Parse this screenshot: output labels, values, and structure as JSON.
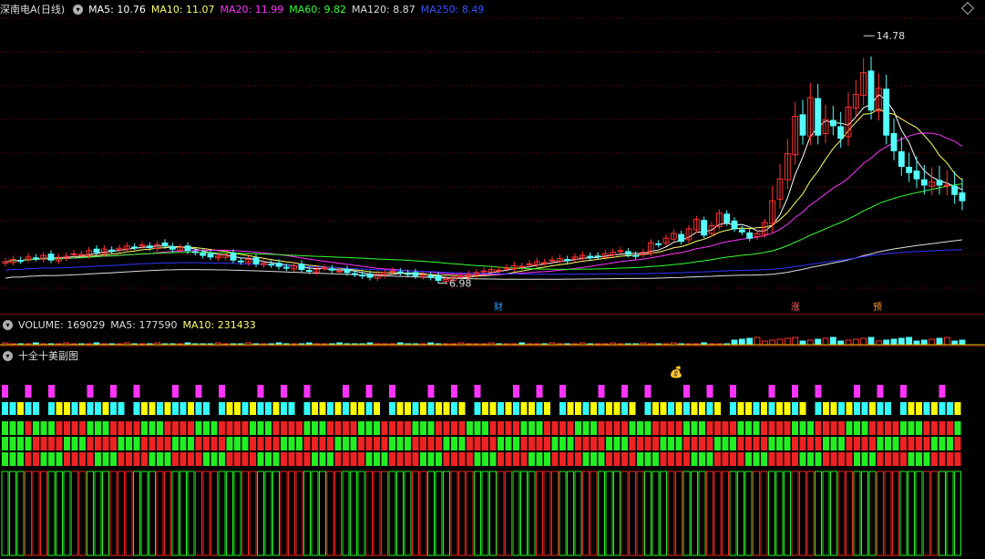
{
  "colors": {
    "up": "#ff3232",
    "down": "#54ffff",
    "grid": "#8b0000",
    "ma5": "#ffffff",
    "ma10": "#ffff66",
    "ma20": "#ff33ff",
    "ma60": "#33ff33",
    "ma120": "#dddddd",
    "ma250": "#3333ff"
  },
  "legend": {
    "stock": "深南电A(日线)",
    "ma5": "MA5: 10.76",
    "ma10": "MA10: 11.07",
    "ma20": "MA20: 11.99",
    "ma60": "MA60: 9.82",
    "ma120": "MA120: 8.87",
    "ma250": "MA250: 8.49"
  },
  "volume_legend": {
    "volume": "VOLUME: 169029",
    "ma5": "MA5: 177590",
    "ma10": "MA10: 231433"
  },
  "sub_legend": {
    "title": "十全十美副图"
  },
  "tags": {
    "cai": "财",
    "zhang": "涨",
    "yu": "预",
    "moneybag": "💰"
  },
  "chart_data": {
    "type": "candlestick",
    "price_range": [
      6.0,
      15.4
    ],
    "high_label": "14.78",
    "low_label": "6.98",
    "closes": [
      7.55,
      7.62,
      7.58,
      7.7,
      7.66,
      7.74,
      7.6,
      7.69,
      7.72,
      7.8,
      7.78,
      7.9,
      7.85,
      7.95,
      7.88,
      7.98,
      8.05,
      8.02,
      8.08,
      8.0,
      8.1,
      8.06,
      7.95,
      8.0,
      7.9,
      7.85,
      7.75,
      7.7,
      7.72,
      7.78,
      7.6,
      7.55,
      7.62,
      7.48,
      7.5,
      7.45,
      7.4,
      7.35,
      7.42,
      7.3,
      7.25,
      7.3,
      7.35,
      7.28,
      7.25,
      7.2,
      7.15,
      7.1,
      7.05,
      7.15,
      7.2,
      7.25,
      7.2,
      7.15,
      7.1,
      7.12,
      7.05,
      6.95,
      6.98,
      7.05,
      7.1,
      7.15,
      7.2,
      7.25,
      7.3,
      7.28,
      7.35,
      7.42,
      7.4,
      7.48,
      7.55,
      7.52,
      7.6,
      7.65,
      7.58,
      7.7,
      7.75,
      7.68,
      7.72,
      7.8,
      7.85,
      7.9,
      7.78,
      7.72,
      7.85,
      8.15,
      8.1,
      8.3,
      8.45,
      8.2,
      8.6,
      8.9,
      8.4,
      8.7,
      9.1,
      8.8,
      8.6,
      8.5,
      8.3,
      8.45,
      8.8,
      9.5,
      10.2,
      11.0,
      12.2,
      11.6,
      12.8,
      11.6,
      12.1,
      11.9,
      11.5,
      12.5,
      12.9,
      13.6,
      12.4,
      13.1,
      11.6,
      11.1,
      10.6,
      10.4,
      10.2,
      10.0,
      10.1,
      10.0,
      10.0,
      9.7,
      9.5
    ],
    "ma_labels": [
      "MA5",
      "MA10",
      "MA20",
      "MA60",
      "MA120",
      "MA250"
    ],
    "volume": {
      "last": 169029,
      "ma5": 177590,
      "ma10": 231433
    },
    "ylabel": "",
    "xlabel": ""
  }
}
